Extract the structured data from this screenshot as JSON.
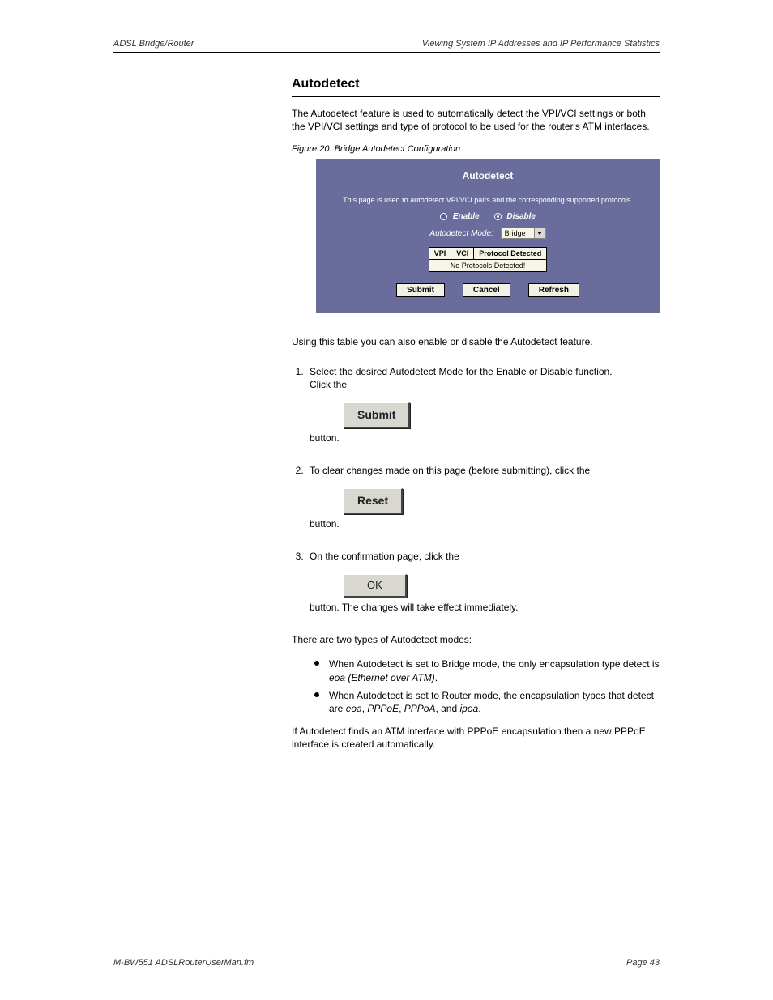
{
  "header": {
    "left": "ADSL Bridge/Router",
    "right": "Viewing System IP Addresses and IP Performance Statistics"
  },
  "section": {
    "title": "Autodetect",
    "intro": "The Autodetect feature is used to automatically detect the VPI/VCI settings or both the VPI/VCI settings and type of protocol to be used for the router's ATM interfaces.",
    "figcap": "Figure 20. Bridge Autodetect Configuration"
  },
  "autodetect": {
    "title": "Autodetect",
    "desc": "This page is used to autodetect VPI/VCI pairs and the corresponding supported protocols.",
    "enable": "Enable",
    "disable": "Disable",
    "mode_label": "Autodetect Mode:",
    "mode_value": "Bridge",
    "table": {
      "h1": "VPI",
      "h2": "VCI",
      "h3": "Protocol Detected",
      "empty": "No Protocols Detected!"
    },
    "submit": "Submit",
    "cancel": "Cancel",
    "refresh": "Refresh"
  },
  "after_fig": "Using this table you can also enable or disable the Autodetect feature.",
  "list": {
    "item1_a": "Select the desired Autodetect Mode for the Enable or Disable function.",
    "item1_b": "Click the ",
    "item1_c": " button.",
    "btn_submit": "Submit",
    "item2_a": "To clear changes made on this page (before submitting), click the",
    "btn_reset": "Reset",
    "item2_b": " button.",
    "item3_a": "On the confirmation page, click the ",
    "btn_ok": "OK",
    "item3_b": " button. The changes will take effect immediately."
  },
  "modes": {
    "intro": "There are two types of Autodetect modes:",
    "b1_a": "When Autodetect is set to Bridge mode, the only encapsulation type detect is ",
    "b1_b": "eoa (Ethernet over ATM)",
    "b1_c": ".",
    "b2_a": "When Autodetect is set to Router mode, the encapsulation types that detect are ",
    "b2_b": "eoa",
    "b2_c": ", ",
    "b2_d": "PPPoE",
    "b2_e": ", ",
    "b2_f": "PPPoA",
    "b2_g": ", and ",
    "b2_h": "ipoa",
    "b2_i": "."
  },
  "pppoe_para": "If Autodetect finds an ATM interface with PPPoE encapsulation then a new PPPoE interface is created automatically.",
  "footer": {
    "left": "M-BW551 ADSLRouterUserMan.fm",
    "right": "Page 43"
  }
}
